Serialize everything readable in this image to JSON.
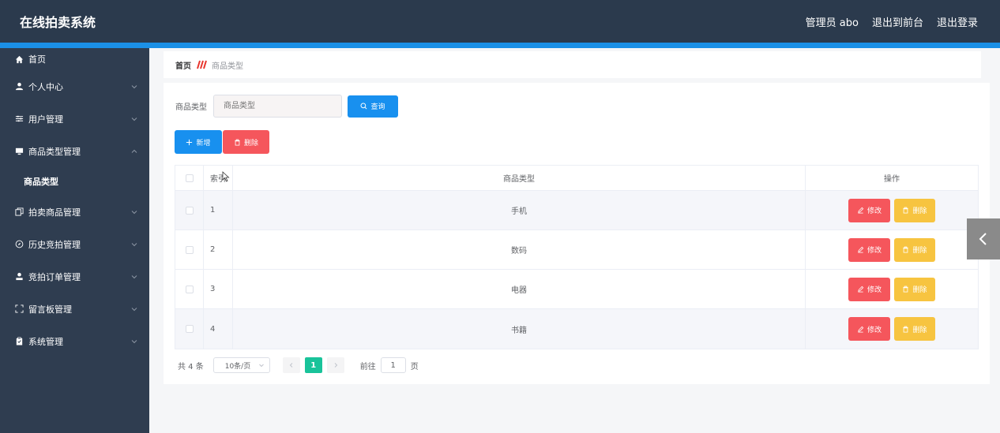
{
  "header": {
    "title": "在线拍卖系统",
    "admin_label": "管理员 abo",
    "back_front": "退出到前台",
    "logout": "退出登录"
  },
  "sidebar": {
    "items": [
      {
        "label": "首页",
        "icon": "home-icon"
      },
      {
        "label": "个人中心",
        "icon": "user-icon"
      },
      {
        "label": "用户管理",
        "icon": "sliders-icon"
      },
      {
        "label": "商品类型管理",
        "icon": "monitor-icon"
      },
      {
        "label": "商品类型",
        "icon": ""
      },
      {
        "label": "拍卖商品管理",
        "icon": "copy-icon"
      },
      {
        "label": "历史竞拍管理",
        "icon": "compass-icon"
      },
      {
        "label": "竞拍订单管理",
        "icon": "person-icon"
      },
      {
        "label": "留言板管理",
        "icon": "fullscreen-icon"
      },
      {
        "label": "系统管理",
        "icon": "clipboard-icon"
      }
    ]
  },
  "breadcrumb": {
    "home": "首页",
    "current": "商品类型"
  },
  "search": {
    "label": "商品类型",
    "placeholder": "商品类型",
    "button": "查询"
  },
  "actions": {
    "add": "新增",
    "delete": "删除"
  },
  "table": {
    "headers": {
      "index": "索引",
      "type": "商品类型",
      "ops": "操作"
    },
    "rows": [
      {
        "index": "1",
        "type": "手机"
      },
      {
        "index": "2",
        "type": "数码"
      },
      {
        "index": "3",
        "type": "电器"
      },
      {
        "index": "4",
        "type": "书籍"
      }
    ],
    "edit_label": "修改",
    "delete_label": "删除"
  },
  "pagination": {
    "total": "共 4 条",
    "page_size": "10条/页",
    "current_page": "1",
    "goto_label": "前往",
    "goto_value": "1",
    "page_unit": "页"
  },
  "colors": {
    "header_bg": "#2b3a4d",
    "accent_blue": "#1890ef",
    "danger": "#f5565c",
    "warning": "#f7c440",
    "page_active": "#19c39a"
  }
}
